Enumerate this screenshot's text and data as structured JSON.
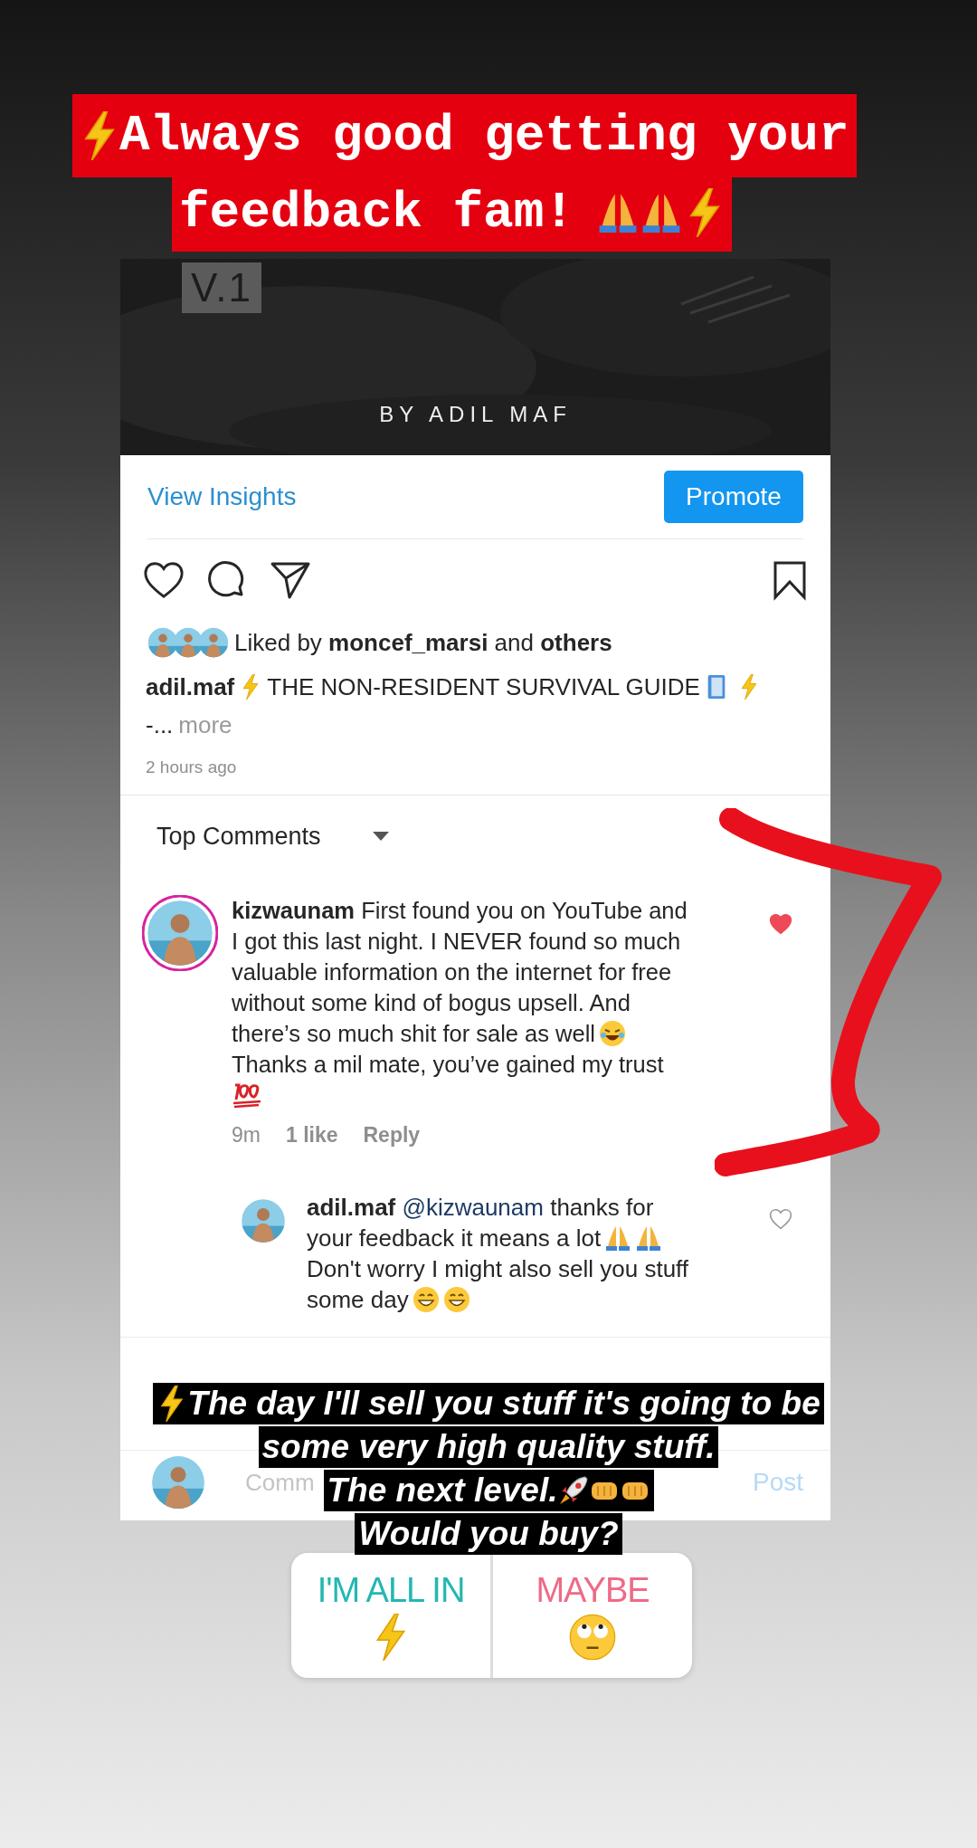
{
  "caption": {
    "lines": [
      "Always good getting your",
      "feedback fam!"
    ]
  },
  "post": {
    "cover_badge": "V.1",
    "cover_byline": "BY ADIL MAF",
    "insights_link": "View Insights",
    "promote_button": "Promote",
    "liked": false,
    "saved": false,
    "liked_by": "Liked by **moncef_marsi** and **others**",
    "caption": {
      "user": "adil.maf",
      "text": "THE NON-RESIDENT SURVIVAL GUIDE",
      "tail": "-...",
      "more": "more"
    },
    "time": "2 hours ago"
  },
  "comments_header": {
    "label": "Top Comments"
  },
  "comments": [
    {
      "kind": "comment",
      "user": "kizwaunam",
      "segments": [
        "First found you on YouTube and I got this last night. I NEVER found so much valuable information on the internet for free without some kind of bogus upsell. And there’s so much shit for sale as well",
        "Thanks a mil mate, you’ve gained my trust"
      ],
      "liked": true,
      "time": "9m",
      "likes": "1 like",
      "reply": "Reply"
    },
    {
      "kind": "reply",
      "user": "adil.maf",
      "mention": "@kizwaunam",
      "segments": [
        "thanks for your feedback it means a lot",
        "Don't worry I might also sell you stuff some day"
      ],
      "liked": false
    }
  ],
  "composer": {
    "placeholder": "Comm",
    "post_button": "Post"
  },
  "overlay_text": {
    "lines": [
      "The day I'll sell you stuff it's going to be",
      "some very high quality stuff.",
      "The next level.",
      "Would you buy?"
    ]
  },
  "poll": {
    "options": [
      {
        "label": "I'M ALL IN",
        "color": "#22b8b0"
      },
      {
        "label": "MAYBE",
        "color": "#ee6a86"
      }
    ]
  }
}
